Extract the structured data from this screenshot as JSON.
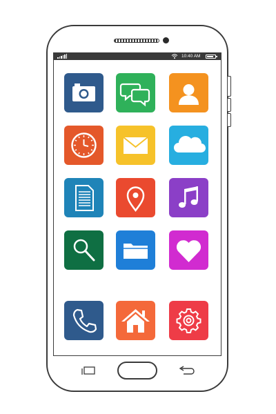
{
  "status_bar": {
    "time": "10:40 AM",
    "signal_icon": "signal-bars-icon",
    "wifi_icon": "wifi-icon",
    "battery_icon": "battery-icon",
    "battery_level": 0.85
  },
  "apps": [
    {
      "icon": "camera-icon",
      "color": "#2f5a8c"
    },
    {
      "icon": "chat-bubbles-icon",
      "color": "#2fb15a"
    },
    {
      "icon": "contacts-icon",
      "color": "#f4921f"
    },
    {
      "icon": "clock-icon",
      "color": "#e4582a"
    },
    {
      "icon": "mail-icon",
      "color": "#f6c22a"
    },
    {
      "icon": "cloud-icon",
      "color": "#27aee0"
    },
    {
      "icon": "document-icon",
      "color": "#1f84b8"
    },
    {
      "icon": "map-pin-icon",
      "color": "#ea4a2f"
    },
    {
      "icon": "music-icon",
      "color": "#8b3fc7"
    },
    {
      "icon": "search-icon",
      "color": "#0f6f43"
    },
    {
      "icon": "folder-icon",
      "color": "#1f7fd8"
    },
    {
      "icon": "heart-icon",
      "color": "#d12bd0"
    }
  ],
  "dock": [
    {
      "icon": "phone-icon",
      "color": "#2f5a8c"
    },
    {
      "icon": "home-icon",
      "color": "#f4693a"
    },
    {
      "icon": "settings-gear-icon",
      "color": "#ee3c47"
    }
  ],
  "hardware_buttons": {
    "recent_apps_icon": "recent-apps-icon",
    "home_button": "home-button",
    "back_icon": "back-arrow-icon"
  }
}
